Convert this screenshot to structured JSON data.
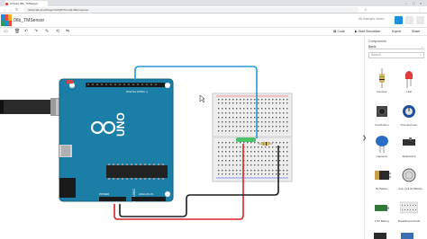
{
  "browser": {
    "tab_title": "Circuits 06b_TMSensor",
    "url": "tinkercad.com/things/7XUQ5TOmrq3-06btmsensor"
  },
  "header": {
    "project_title": "06b_TMSensor",
    "user_text": "All changes saved"
  },
  "toolbar": {
    "code_label": "Code",
    "start_label": "Start Simulation",
    "export_label": "Export",
    "share_label": "Share"
  },
  "board": {
    "brand": "UNO",
    "maker": "ARDUINO",
    "digital_label": "DIGITAL (PWM ~)",
    "power_label": "POWER",
    "analog_label": "ANALOG IN"
  },
  "panel": {
    "title": "Components",
    "category": "Basic",
    "search_placeholder": "Search",
    "components": [
      {
        "name": "Resistor",
        "icon": "resistor-icon"
      },
      {
        "name": "LED",
        "icon": "led-icon"
      },
      {
        "name": "Pushbutton",
        "icon": "pushbutton-icon"
      },
      {
        "name": "Potentiometer",
        "icon": "potentiometer-icon"
      },
      {
        "name": "Capacitor",
        "icon": "capacitor-icon"
      },
      {
        "name": "Slideswitch",
        "icon": "slideswitch-icon"
      },
      {
        "name": "9V Battery",
        "icon": "battery-9v-icon"
      },
      {
        "name": "Coin Cell 3V Battery",
        "icon": "coin-cell-icon"
      },
      {
        "name": "1.5V Battery",
        "icon": "battery-aa-icon"
      },
      {
        "name": "Breadboard Small",
        "icon": "breadboard-small-icon"
      }
    ]
  },
  "colors": {
    "accent": "#1477d4",
    "board": "#1b7ea6",
    "wire_blue": "#2a97d6",
    "wire_red": "#d6252a",
    "wire_black": "#1c1c1c"
  }
}
